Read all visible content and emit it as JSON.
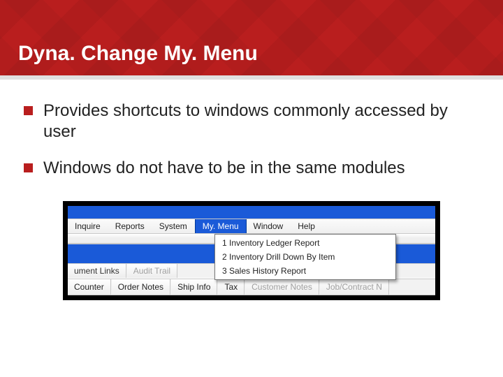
{
  "slide": {
    "title": "Dyna. Change My. Menu",
    "bullets": [
      "Provides shortcuts to windows commonly accessed by user",
      "Windows do not have to be in the same modules"
    ]
  },
  "menubar": {
    "items": [
      {
        "label": "Inquire",
        "active": false
      },
      {
        "label": "Reports",
        "active": false
      },
      {
        "label": "System",
        "active": false
      },
      {
        "label": "My. Menu",
        "active": true
      },
      {
        "label": "Window",
        "active": false
      },
      {
        "label": "Help",
        "active": false
      }
    ]
  },
  "dropdown": {
    "items": [
      "1 Inventory Ledger Report",
      "2 Inventory Drill Down By Item",
      "3 Sales History Report"
    ]
  },
  "tab_row_upper": {
    "items": [
      {
        "label": "ument Links",
        "dim": false
      },
      {
        "label": "Audit Trail",
        "dim": true
      }
    ]
  },
  "tab_row_lower": {
    "items": [
      {
        "label": "Counter",
        "dim": false
      },
      {
        "label": "Order Notes",
        "dim": false
      },
      {
        "label": "Ship Info",
        "dim": false
      },
      {
        "label": "Tax",
        "dim": false
      },
      {
        "label": "Customer Notes",
        "dim": true
      },
      {
        "label": "Job/Contract N",
        "dim": true
      }
    ]
  }
}
